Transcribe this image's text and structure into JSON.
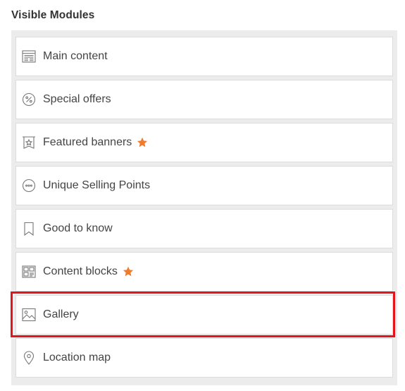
{
  "section": {
    "title": "Visible Modules"
  },
  "modules": [
    {
      "label": "Main content",
      "icon": "layout-icon",
      "starred": false
    },
    {
      "label": "Special offers",
      "icon": "percent-badge-icon",
      "starred": false
    },
    {
      "label": "Featured banners",
      "icon": "banner-star-icon",
      "starred": true
    },
    {
      "label": "Unique Selling Points",
      "icon": "dots-circle-icon",
      "starred": false
    },
    {
      "label": "Good to know",
      "icon": "bookmark-icon",
      "starred": false
    },
    {
      "label": "Content blocks",
      "icon": "blocks-icon",
      "starred": true
    },
    {
      "label": "Gallery",
      "icon": "image-icon",
      "starred": false,
      "highlighted": true
    },
    {
      "label": "Location map",
      "icon": "map-pin-icon",
      "starred": false
    }
  ],
  "colors": {
    "star": "#f07b2c",
    "highlight": "#e4141b",
    "panel": "#ececec",
    "icon": "#777777"
  }
}
